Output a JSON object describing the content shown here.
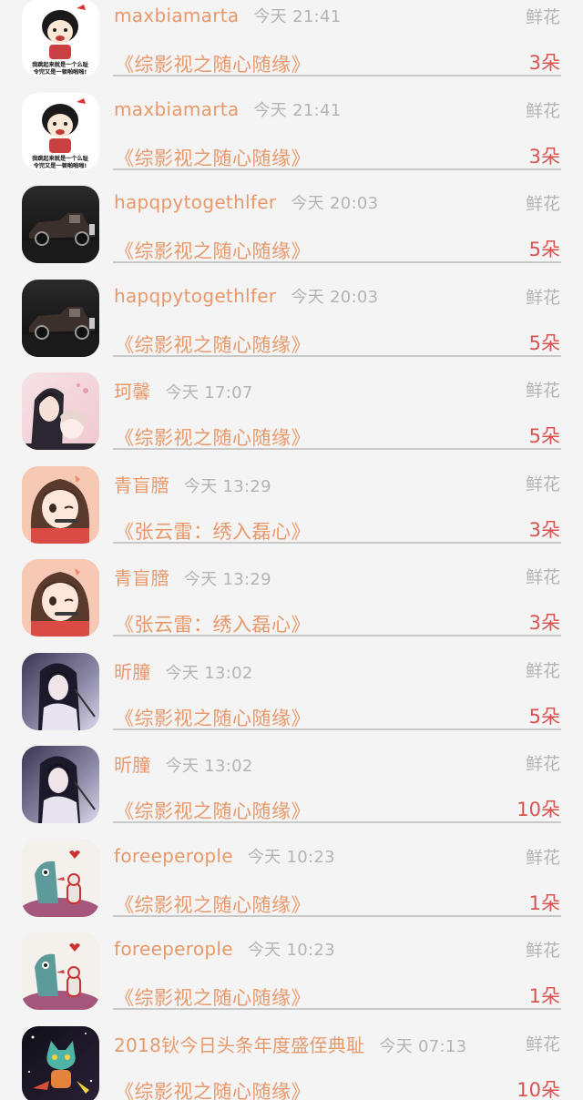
{
  "records": [
    {
      "user": "maxbiamarta",
      "time": "今天 21:41",
      "gift": "鲜花",
      "book": "《综影视之随心随缘》",
      "count": "3朵",
      "avatar": "meme-face-icon"
    },
    {
      "user": "maxbiamarta",
      "time": "今天 21:41",
      "gift": "鲜花",
      "book": "《综影视之随心随缘》",
      "count": "3朵",
      "avatar": "meme-face-icon"
    },
    {
      "user": "hapqpytogethlfer",
      "time": "今天 20:03",
      "gift": "鲜花",
      "book": "《综影视之随心随缘》",
      "count": "5朵",
      "avatar": "vintage-car-icon"
    },
    {
      "user": "hapqpytogethlfer",
      "time": "今天 20:03",
      "gift": "鲜花",
      "book": "《综影视之随心随缘》",
      "count": "5朵",
      "avatar": "vintage-car-icon"
    },
    {
      "user": "珂馨",
      "time": "今天 17:07",
      "gift": "鲜花",
      "book": "《综影视之随心随缘》",
      "count": "5朵",
      "avatar": "anime-couple-icon"
    },
    {
      "user": "青盲膪",
      "time": "今天 13:29",
      "gift": "鲜花",
      "book": "《张云雷：绣入磊心》",
      "count": "3朵",
      "avatar": "anime-girl-icon"
    },
    {
      "user": "青盲膪",
      "time": "今天 13:29",
      "gift": "鲜花",
      "book": "《张云雷：绣入磊心》",
      "count": "3朵",
      "avatar": "anime-girl-icon"
    },
    {
      "user": "昕朣",
      "time": "今天 13:02",
      "gift": "鲜花",
      "book": "《综影视之随心随缘》",
      "count": "5朵",
      "avatar": "painted-lady-icon"
    },
    {
      "user": "昕朣",
      "time": "今天 13:02",
      "gift": "鲜花",
      "book": "《综影视之随心随缘》",
      "count": "10朵",
      "avatar": "painted-lady-icon"
    },
    {
      "user": "foreeperople",
      "time": "今天 10:23",
      "gift": "鲜花",
      "book": "《综影视之随心随缘》",
      "count": "1朵",
      "avatar": "cartoon-dino-icon"
    },
    {
      "user": "foreeperople",
      "time": "今天 10:23",
      "gift": "鲜花",
      "book": "《综影视之随心随缘》",
      "count": "1朵",
      "avatar": "cartoon-dino-icon"
    },
    {
      "user": "2018钬今日头条年度盛侄典耻",
      "time": "今天 07:13",
      "gift": "鲜花",
      "book": "《综影视之随心随缘》",
      "count": "10朵",
      "avatar": "space-cat-icon"
    }
  ],
  "meme_caption_1": "我跳起来就是一个么耻",
  "meme_caption_2": "令完又是一顿啪啪啪!"
}
